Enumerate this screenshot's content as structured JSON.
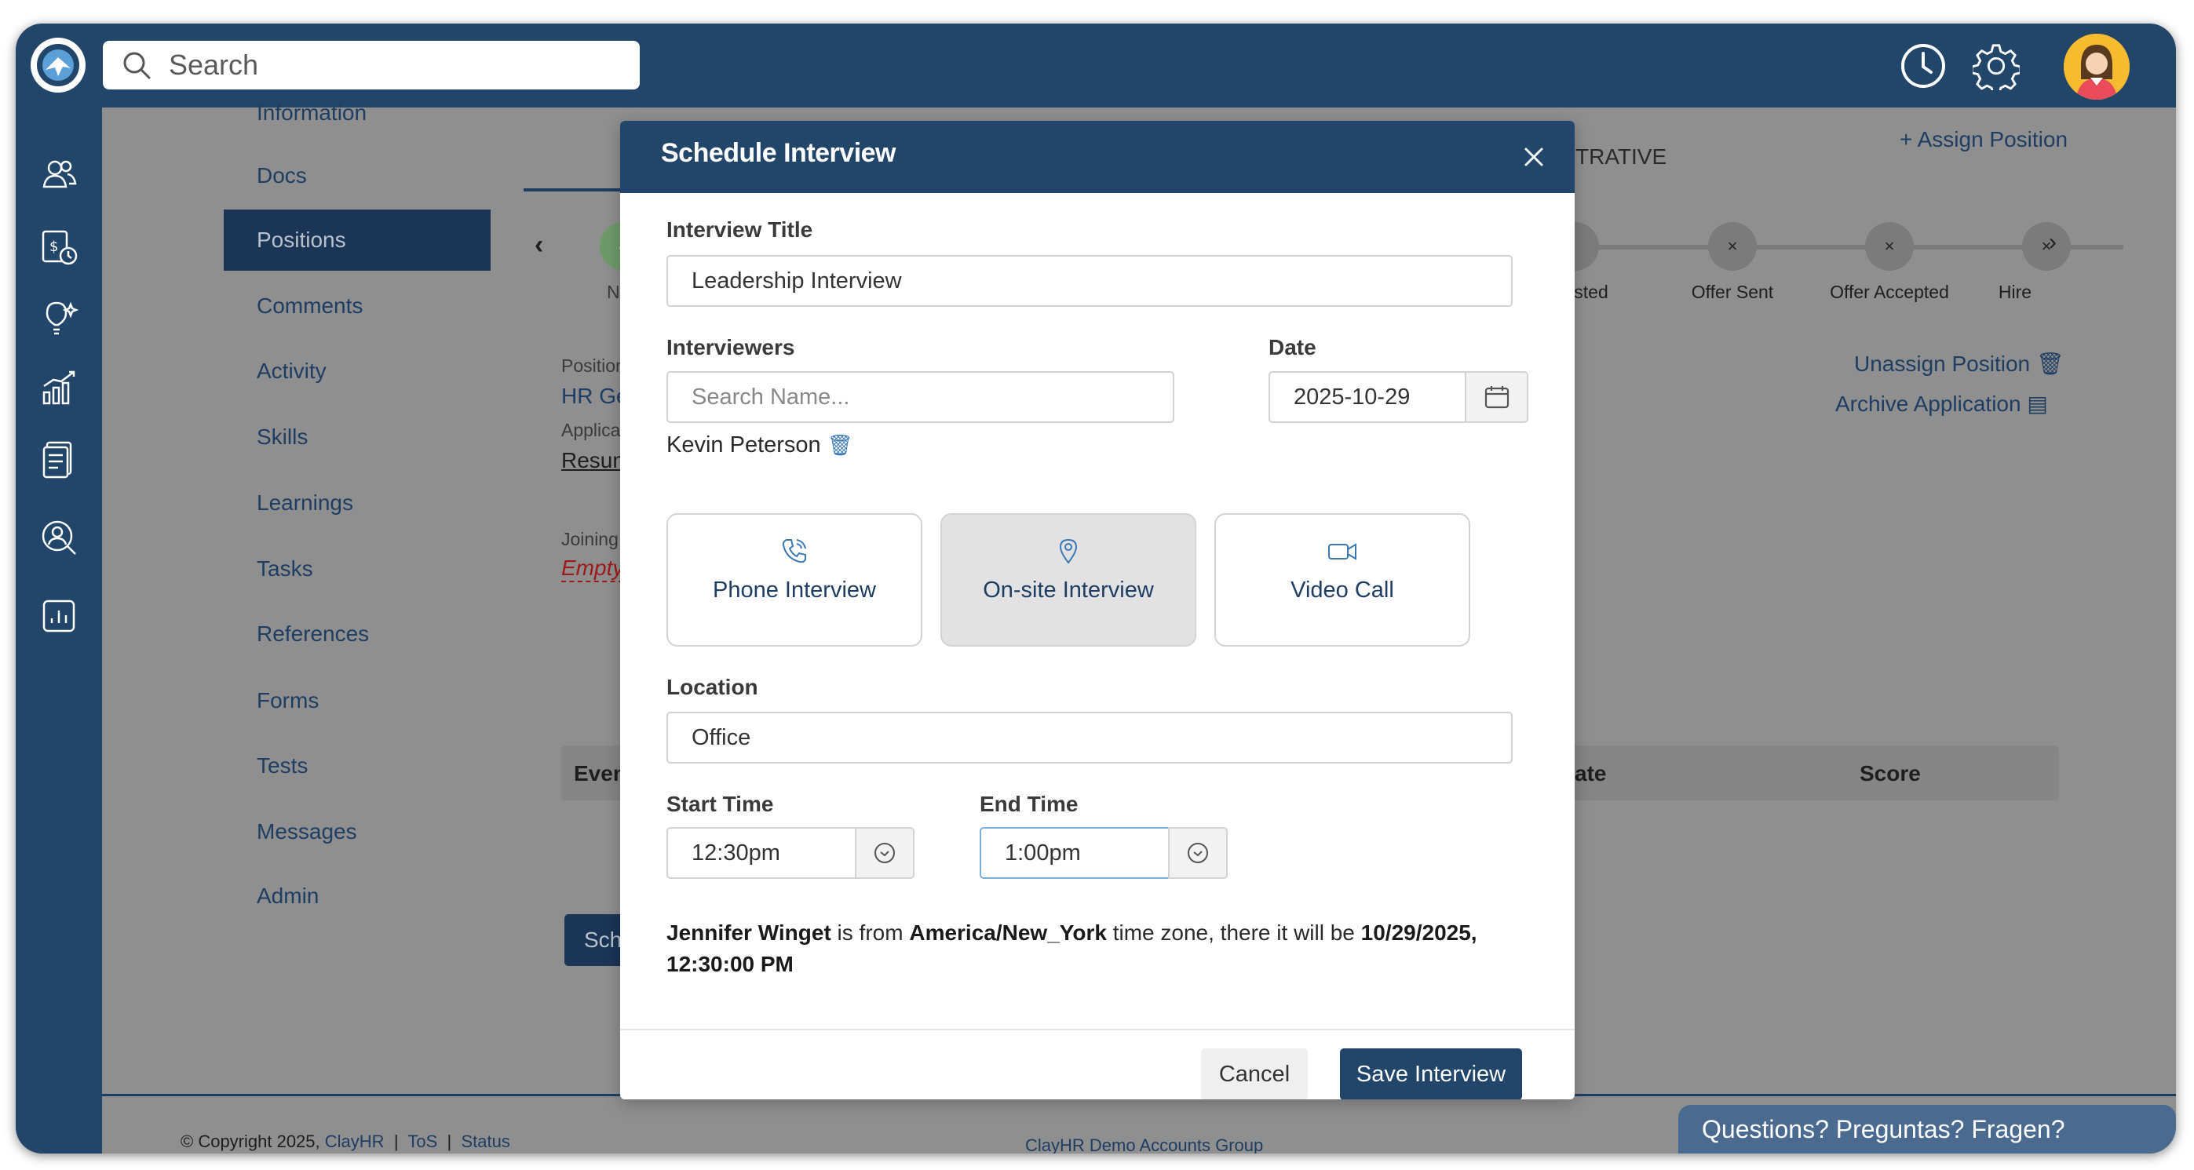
{
  "header": {
    "search_placeholder": "Search"
  },
  "colors": {
    "brand": "#22456a",
    "link": "#1e3d63",
    "overlay_gray": "#8f8f8f",
    "avatar_bg": "#f6bb2e"
  },
  "icons": {
    "top": [
      "clock-icon",
      "gear-icon",
      "avatar"
    ],
    "rail": [
      "people-icon",
      "payroll-icon",
      "lightbulb-icon",
      "chart-icon",
      "document-icon",
      "person-search-icon",
      "report-icon"
    ]
  },
  "subnav": {
    "items": [
      {
        "label": "Information"
      },
      {
        "label": "Docs"
      },
      {
        "label": "Positions"
      },
      {
        "label": "Comments"
      },
      {
        "label": "Activity"
      },
      {
        "label": "Skills"
      },
      {
        "label": "Learnings"
      },
      {
        "label": "Tasks"
      },
      {
        "label": "References"
      },
      {
        "label": "Forms"
      },
      {
        "label": "Tests"
      },
      {
        "label": "Messages"
      },
      {
        "label": "Admin"
      }
    ],
    "active_index": 2
  },
  "background": {
    "tab_fragment": "TRATIVE",
    "assign_position": "Assign Position",
    "pipeline": {
      "first_step_label": "Ne",
      "steps": [
        {
          "label": "sted"
        },
        {
          "label": "Offer Sent"
        },
        {
          "label": "Offer Accepted"
        },
        {
          "label": "Hire"
        }
      ]
    },
    "position_label": "Position I",
    "position_value": "HR Gen",
    "application_label": "Applicati",
    "resume_link": "Resume",
    "joining_label": "Joining D",
    "joining_value": "Empty",
    "unassign_position": "Unassign Position",
    "archive_application": "Archive Application",
    "table": {
      "event_header": "Event",
      "date_header": "ate",
      "score_header": "Score"
    },
    "schedule_button_fragment": "Sche",
    "footer": {
      "copyright": "© Copyright 2025,",
      "company_link": "ClayHR",
      "tos": "ToS",
      "status": "Status",
      "separator": "|",
      "group": "ClayHR Demo Accounts Group"
    },
    "chat_widget": "Questions? Preguntas? Fragen?"
  },
  "modal": {
    "title": "Schedule Interview",
    "interview_title_label": "Interview Title",
    "interview_title_value": "Leadership Interview",
    "interviewers_label": "Interviewers",
    "interviewers_placeholder": "Search Name...",
    "interviewer_selected": "Kevin Peterson",
    "date_label": "Date",
    "date_value": "2025-10-29",
    "types": [
      {
        "label": "Phone Interview",
        "icon": "phone-icon",
        "selected": false
      },
      {
        "label": "On-site Interview",
        "icon": "location-pin-icon",
        "selected": true
      },
      {
        "label": "Video Call",
        "icon": "video-camera-icon",
        "selected": false
      }
    ],
    "location_label": "Location",
    "location_value": "Office",
    "start_time_label": "Start Time",
    "start_time_value": "12:30pm",
    "end_time_label": "End Time",
    "end_time_value": "1:00pm",
    "tz_note": {
      "candidate": "Jennifer Winget",
      "part1": " is from ",
      "timezone": "America/New_York",
      "part2": " time zone, there it will be ",
      "datetime": "10/29/2025, 12:30:00 PM"
    },
    "cancel_label": "Cancel",
    "save_label": "Save Interview"
  }
}
